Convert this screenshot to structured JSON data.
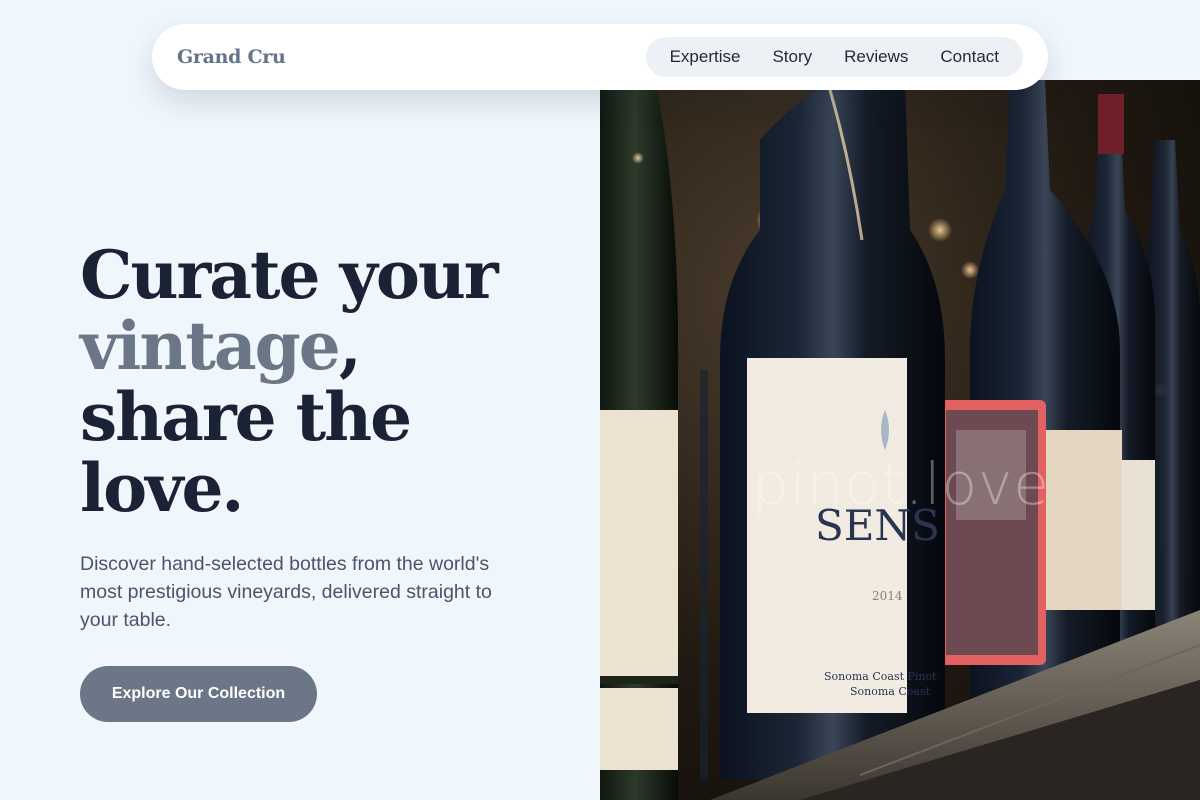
{
  "nav": {
    "brand": "Grand Cru",
    "links": [
      "Expertise",
      "Story",
      "Reviews",
      "Contact"
    ]
  },
  "hero": {
    "headline": {
      "line1": "Curate your",
      "accent": "vintage",
      "comma": ",",
      "line3": "share the",
      "line4": "love."
    },
    "subtext": "Discover hand-selected bottles from the world's most prestigious vineyards, delivered straight to your table.",
    "cta_label": "Explore Our Collection"
  },
  "image": {
    "watermark": "pinot.love",
    "label_brand": "SENS",
    "label_year": "2014",
    "label_line1": "Sonoma Coast Pinot",
    "label_line2": "Sonoma Coast"
  },
  "colors": {
    "background": "#eff6fc",
    "headline": "#1a2236",
    "accent": "#6b7787",
    "button": "#6b7787"
  }
}
